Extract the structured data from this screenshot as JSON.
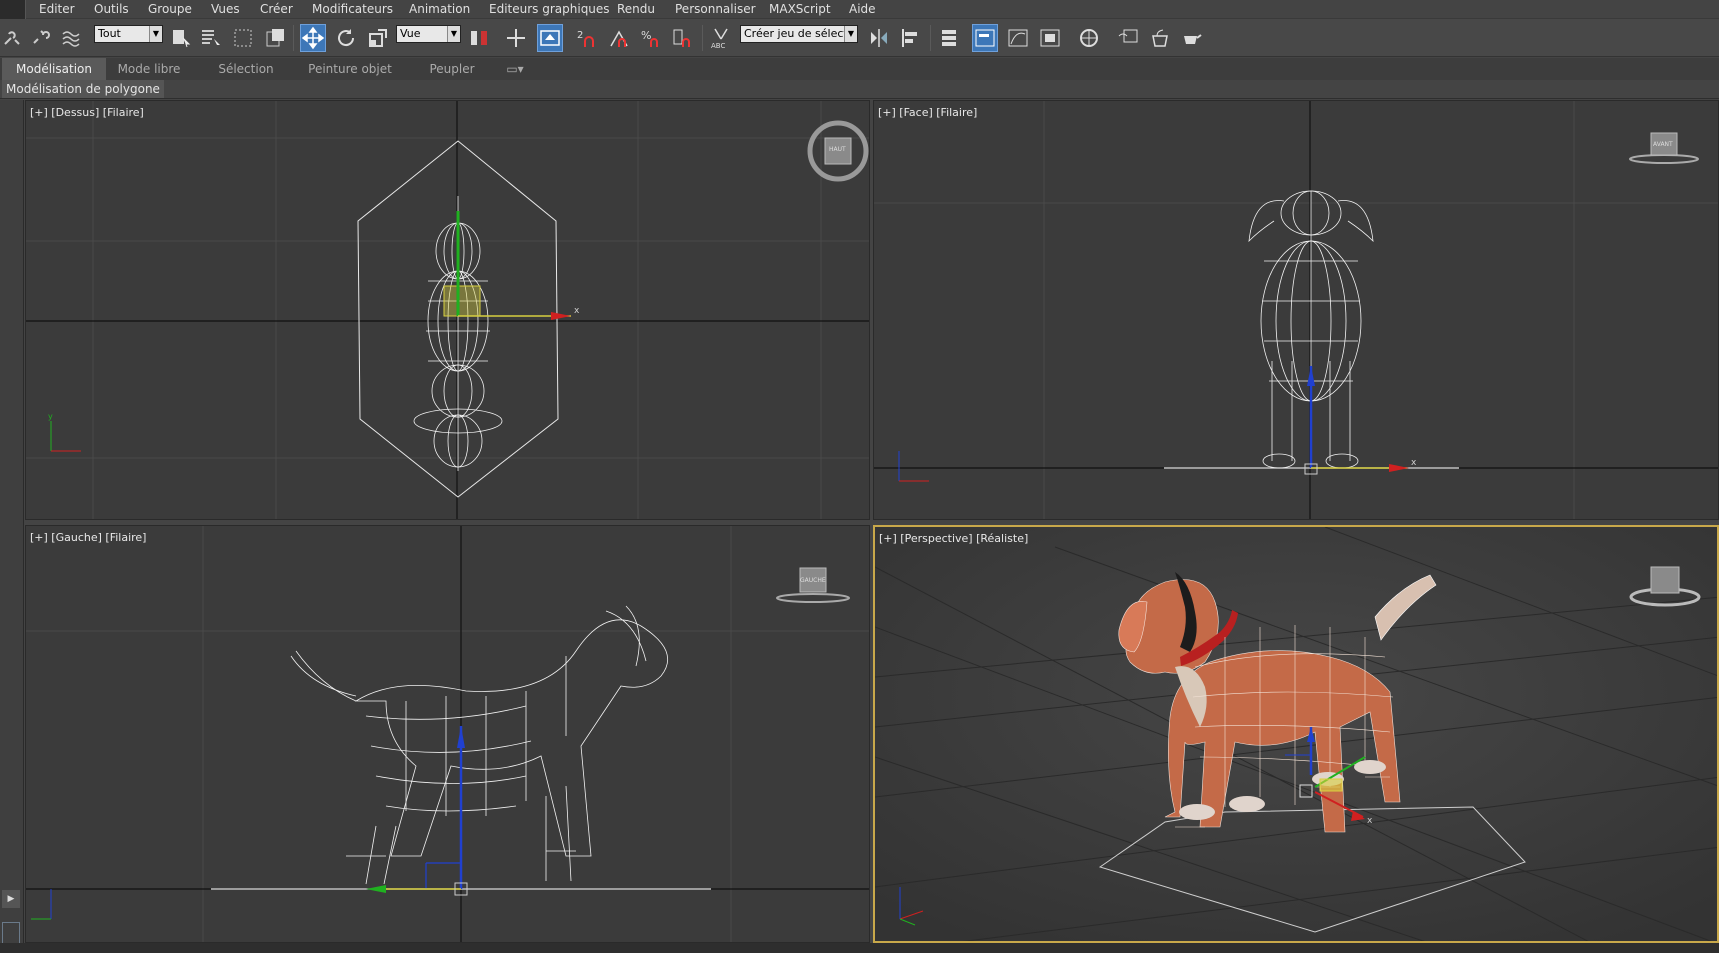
{
  "menu": [
    "Editer",
    "Outils",
    "Groupe",
    "Vues",
    "Créer",
    "Modificateurs",
    "Animation",
    "Editeurs graphiques",
    "Rendu",
    "Personnaliser",
    "MAXScript",
    "Aide"
  ],
  "toolbar": {
    "filter_select": "Tout",
    "coord_select": "Vue",
    "selection_set": "Créer jeu de sélecti"
  },
  "ribbon": {
    "tabs": [
      "Modélisation",
      "Mode libre",
      "Sélection",
      "Peinture objet",
      "Peupler"
    ],
    "active_tab": 0,
    "panel_label": "Modélisation de polygone"
  },
  "viewports": {
    "top": {
      "label": "[+] [Dessus] [Filaire]",
      "cube": "HAUT"
    },
    "front": {
      "label": "[+] [Face] [Filaire]",
      "cube": "AVANT"
    },
    "left": {
      "label": "[+] [Gauche] [Filaire]",
      "cube": "GAUCHE"
    },
    "persp": {
      "label": "[+] [Perspective] [Réaliste]",
      "cube": ""
    }
  },
  "colors": {
    "accent": "#3d77b8",
    "active_border": "#c8a84a",
    "axis_x": "#d02020",
    "axis_y": "#20b020",
    "axis_z": "#2040d0"
  }
}
